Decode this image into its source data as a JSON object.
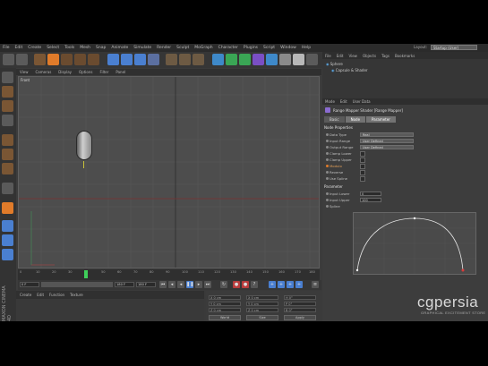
{
  "menubar": {
    "items": [
      "File",
      "Edit",
      "Create",
      "Select",
      "Tools",
      "Mesh",
      "Snap",
      "Animate",
      "Simulate",
      "Render",
      "Sculpt",
      "MoGraph",
      "Character",
      "Plugins",
      "Script",
      "Window",
      "Help"
    ],
    "layout_label": "Layout:",
    "layout_value": "Startup (User)"
  },
  "viewport": {
    "menu": [
      "View",
      "Cameras",
      "Display",
      "Options",
      "Filter",
      "Panel"
    ],
    "label": "Front"
  },
  "timeline": {
    "ticks": [
      "0",
      "10",
      "20",
      "30",
      "40",
      "50",
      "60",
      "70",
      "80",
      "90",
      "100",
      "110",
      "120",
      "130",
      "140",
      "150",
      "160",
      "170",
      "180"
    ],
    "current_frame": "0 F"
  },
  "transport": {
    "start_field": "0 F",
    "end_field": "180 F",
    "current_field": "180 F"
  },
  "object_manager": {
    "menu": [
      "File",
      "Edit",
      "View",
      "Objects",
      "Tags",
      "Bookmarks"
    ],
    "rows": [
      "Sphere",
      "Capsule & Shader"
    ]
  },
  "attributes": {
    "menu": [
      "Mode",
      "Edit",
      "User Data"
    ],
    "title": "Range Mapper Shader [Range Mapper]",
    "tabs": [
      "Basic",
      "Node",
      "Parameter"
    ],
    "section_node": "Node Properties",
    "props": [
      {
        "label": "Data Type",
        "value": "Real"
      },
      {
        "label": "Input Range",
        "value": "User Defined"
      },
      {
        "label": "Output Range",
        "value": "User Defined"
      },
      {
        "label": "Clamp Lower",
        "value": ""
      },
      {
        "label": "Clamp Upper",
        "value": ""
      },
      {
        "label": "Modulo",
        "value": ""
      },
      {
        "label": "Reverse",
        "value": ""
      },
      {
        "label": "Use Spline",
        "value": ""
      }
    ],
    "section_params": "Parameter",
    "params": [
      {
        "label": "Input Lower",
        "value": "0"
      },
      {
        "label": "Input Upper",
        "value": "100"
      },
      {
        "label": "Spline",
        "value": ""
      }
    ]
  },
  "bottom_left": {
    "menu": [
      "Create",
      "Edit",
      "Function",
      "Texture"
    ]
  },
  "coords": {
    "rows": [
      {
        "a": "X  0 cm",
        "b": "X  0 cm",
        "c": "H  0°"
      },
      {
        "a": "Y  0 cm",
        "b": "Y  0 cm",
        "c": "P  0°"
      },
      {
        "a": "Z  0 cm",
        "b": "Z  0 cm",
        "c": "B  0°"
      }
    ],
    "world_label": "World",
    "scale_label": "Size",
    "apply_label": "Apply"
  },
  "branding": {
    "logo": "cgpersia",
    "tagline": "GRAPHICAL EXCITEMENT STORE",
    "maxon": "MAXON CINEMA 4D"
  },
  "colors": {
    "accent_orange": "#e07b2a",
    "accent_blue": "#4a7fd0",
    "playhead_green": "#3fcf5a"
  }
}
